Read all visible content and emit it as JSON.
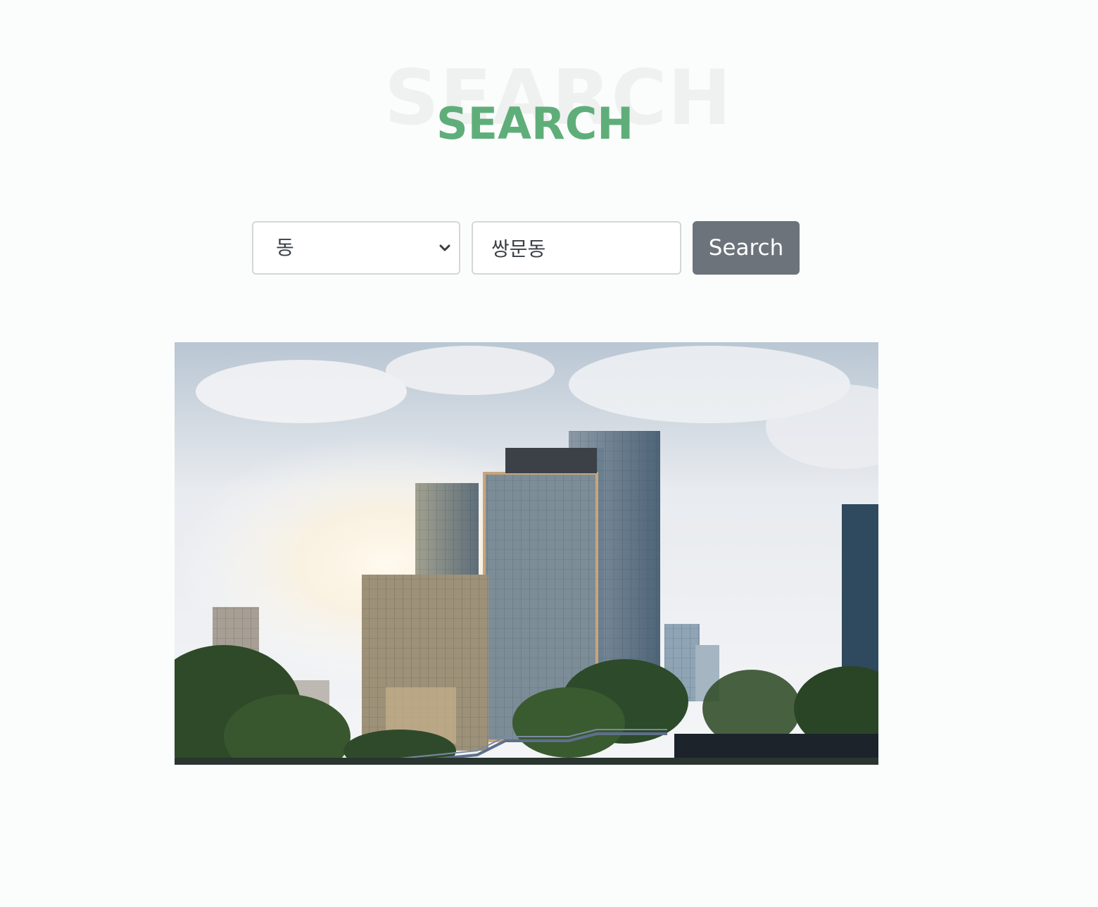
{
  "header": {
    "title_background": "SEARCH",
    "title": "SEARCH"
  },
  "search": {
    "type_select": {
      "selected": "동"
    },
    "query": {
      "value": "쌍문동"
    },
    "button_label": "Search"
  },
  "colors": {
    "accent": "#5fae7a",
    "button": "#6c737b"
  },
  "icons": {
    "select_arrow": "chevron-down-icon"
  },
  "hero": {
    "description": ""
  }
}
